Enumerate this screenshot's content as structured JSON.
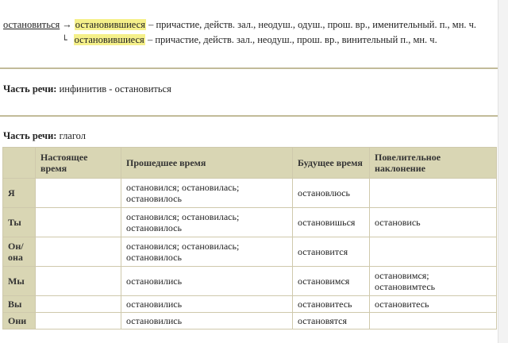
{
  "morphology": {
    "lemma": "остановиться",
    "arrow": "→",
    "corner_glyph": "└",
    "lines": [
      {
        "form": "остановившиеся",
        "desc": " – причастие, действ. зал., неодуш., одуш., прош. вр., именительный. п., мн. ч."
      },
      {
        "form": "остановившиеся",
        "desc": " – причастие, действ. зал., неодуш., прош. вр., винительный п., мн. ч."
      }
    ]
  },
  "pos_blocks": [
    {
      "label": "Часть речи:",
      "value": " инфинитив - остановиться"
    },
    {
      "label": "Часть речи:",
      "value": " глагол"
    }
  ],
  "table": {
    "headers": [
      "",
      "Настоящее время",
      "Прошедшее время",
      "Будущее время",
      "Повелительное наклонение"
    ],
    "rows": [
      {
        "pronoun": "Я",
        "present": "",
        "past": "остановился; остановилась; остановилось",
        "future": "остановлюсь",
        "imperative": ""
      },
      {
        "pronoun": "Ты",
        "present": "",
        "past": "остановился; остановилась; остановилось",
        "future": "остановишься",
        "imperative": "остановись"
      },
      {
        "pronoun": "Он/ она",
        "present": "",
        "past": "остановился; остановилась; остановилось",
        "future": "остановится",
        "imperative": ""
      },
      {
        "pronoun": "Мы",
        "present": "",
        "past": "остановились",
        "future": "остановимся",
        "imperative": "остановимся; остановимтесь"
      },
      {
        "pronoun": "Вы",
        "present": "",
        "past": "остановились",
        "future": "остановитесь",
        "imperative": "остановитесь"
      },
      {
        "pronoun": "Они",
        "present": "",
        "past": "остановились",
        "future": "остановятся",
        "imperative": ""
      }
    ]
  }
}
